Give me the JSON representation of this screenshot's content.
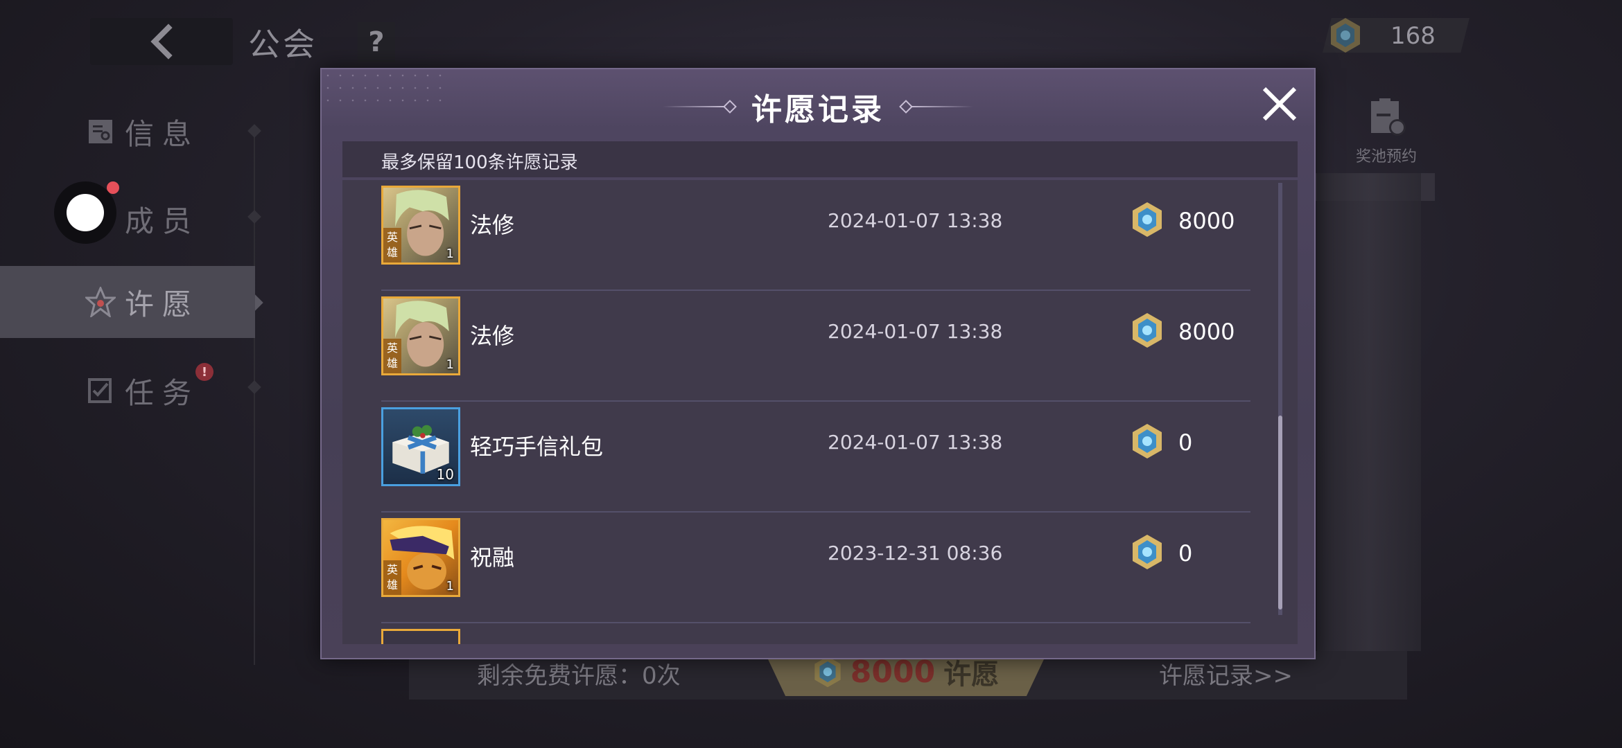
{
  "background": {
    "title": "公会",
    "help_label": "?",
    "currency_value": "168",
    "nav": [
      {
        "label": "信息"
      },
      {
        "label": "成员"
      },
      {
        "label": "许愿"
      },
      {
        "label": "任务"
      }
    ],
    "alert_mark": "!",
    "pool_reserve_label": "奖池预约",
    "free_wishes": "剩余免费许愿：0次",
    "wish_cost": "8000",
    "wish_action": "许愿",
    "record_link": "许愿记录>>"
  },
  "modal": {
    "title": "许愿记录",
    "note": "最多保留100条许愿记录",
    "records": [
      {
        "name": "法修",
        "time": "2024-01-07 13:38",
        "cost": "8000",
        "count": "1",
        "tag": "英雄"
      },
      {
        "name": "法修",
        "time": "2024-01-07 13:38",
        "cost": "8000",
        "count": "1",
        "tag": "英雄"
      },
      {
        "name": "轻巧手信礼包",
        "time": "2024-01-07 13:38",
        "cost": "0",
        "count": "10"
      },
      {
        "name": "祝融",
        "time": "2023-12-31 08:36",
        "cost": "0",
        "count": "1",
        "tag": "英雄"
      }
    ]
  },
  "colors": {
    "accent_gold": "#e9a93a",
    "gift_border": "#4aa0e0",
    "badge_red": "#e7505a",
    "modal_bg": "#463f55"
  }
}
